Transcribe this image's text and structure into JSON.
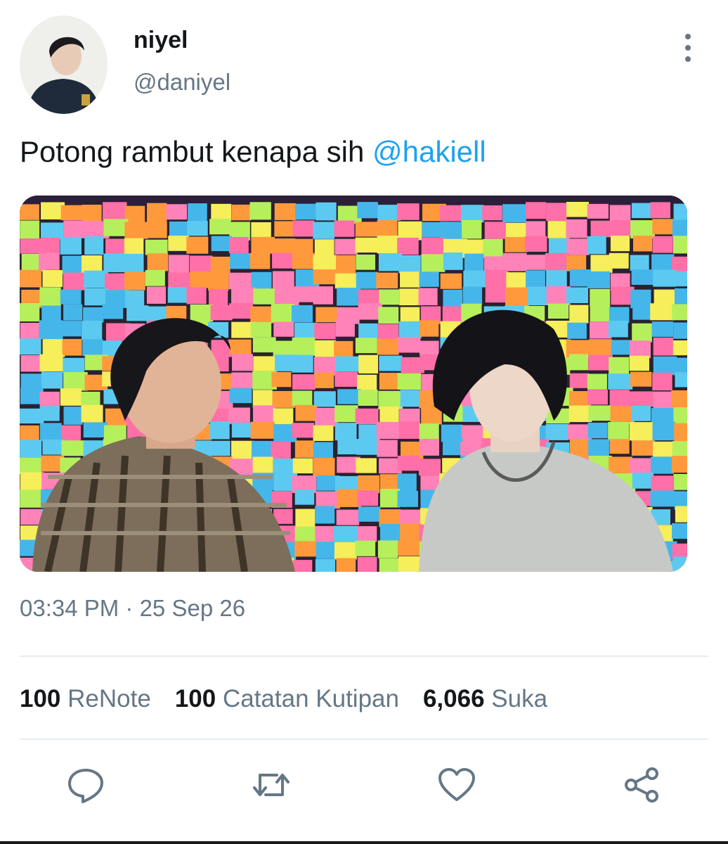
{
  "tweet": {
    "display_name": "niyel",
    "handle": "@daniyel",
    "text": "Potong rambut kenapa sih",
    "mention": "@hakiell",
    "timestamp": "03:34 PM · 25 Sep 26"
  },
  "stats": {
    "renote_count": "100",
    "renote_label": "ReNote",
    "quote_count": "100",
    "quote_label": "Catatan Kutipan",
    "like_count": "6,066",
    "like_label": "Suka"
  },
  "icons": {
    "more": "more-vertical-icon",
    "reply": "reply-icon",
    "renote": "retweet-icon",
    "like": "heart-icon",
    "share": "share-icon"
  },
  "colors": {
    "accent": "#1da1f2",
    "muted": "#657786",
    "text": "#14171a"
  }
}
